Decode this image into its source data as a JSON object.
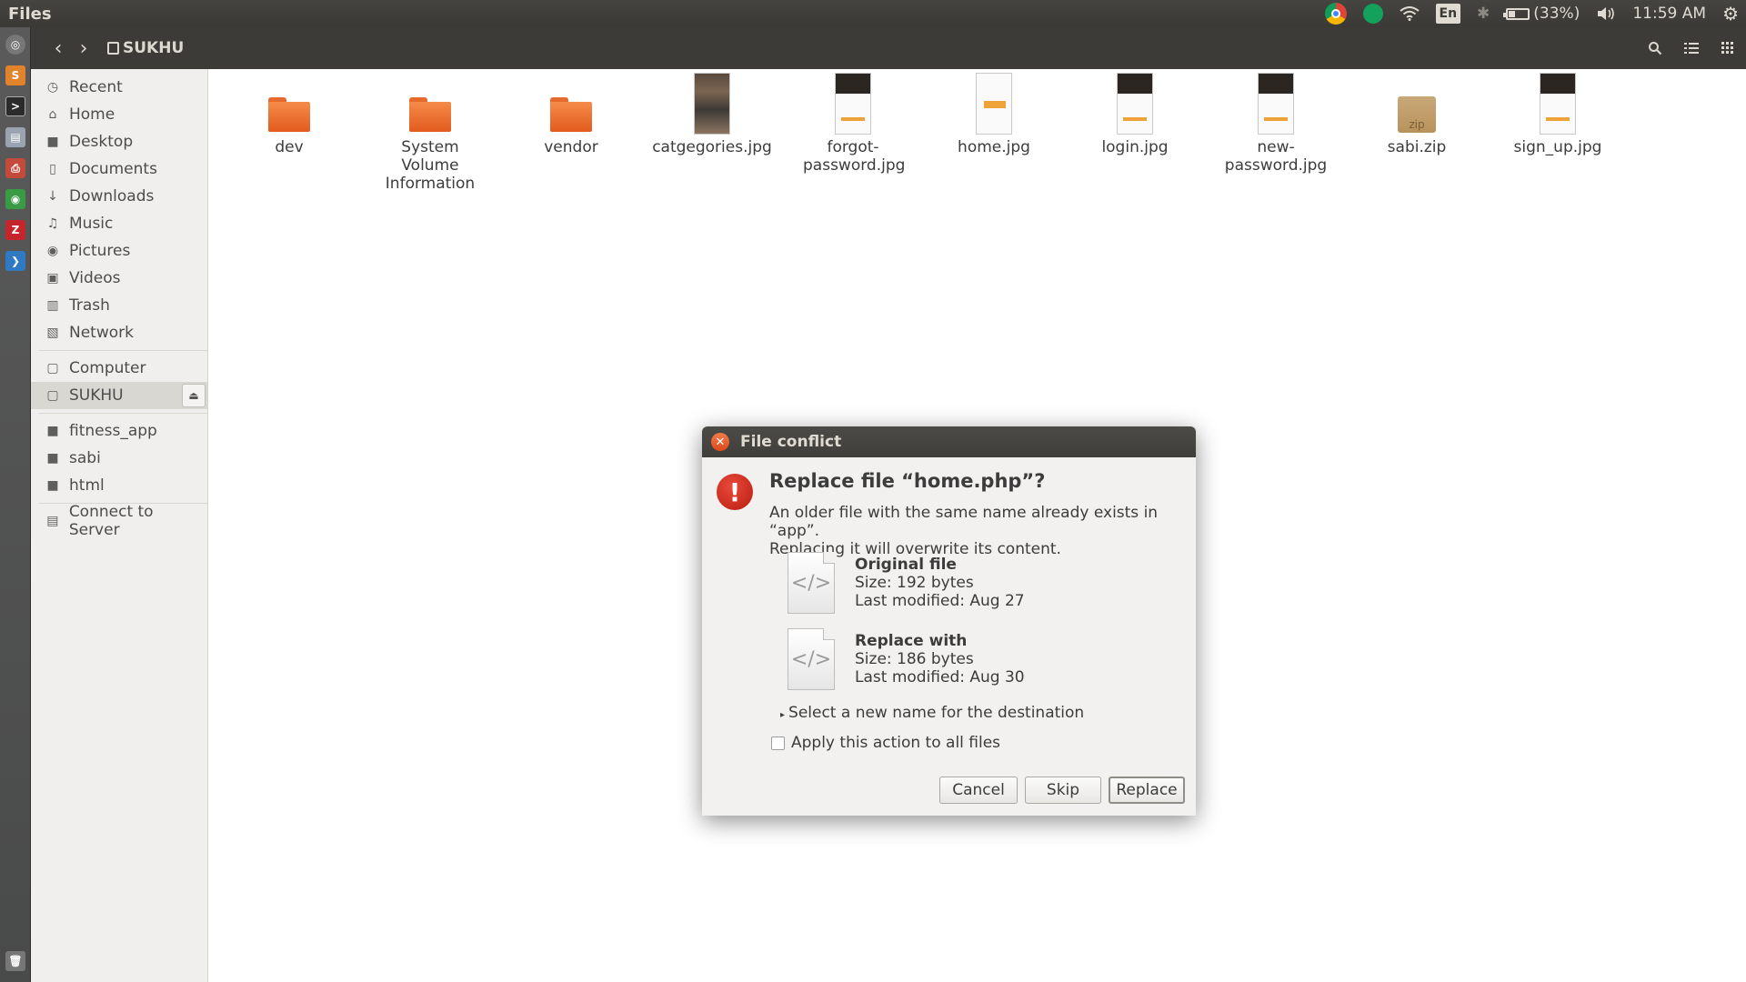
{
  "topbar": {
    "app_title": "Files",
    "indicators": {
      "chrome": "chrome-icon",
      "green": "green-app-icon",
      "wifi": "wifi-icon",
      "language": "En",
      "bluetooth": "bluetooth-icon",
      "battery_text": "(33%)",
      "volume": "volume-icon",
      "clock": "11:59 AM",
      "settings": "gear-icon"
    }
  },
  "headerbar": {
    "path_label": "SUKHU"
  },
  "sidebar": {
    "places": [
      {
        "label": "Recent",
        "icon": "clock-icon"
      },
      {
        "label": "Home",
        "icon": "home-icon"
      },
      {
        "label": "Desktop",
        "icon": "folder-icon"
      },
      {
        "label": "Documents",
        "icon": "document-icon"
      },
      {
        "label": "Downloads",
        "icon": "download-icon"
      },
      {
        "label": "Music",
        "icon": "music-icon"
      },
      {
        "label": "Pictures",
        "icon": "camera-icon"
      },
      {
        "label": "Videos",
        "icon": "video-icon"
      },
      {
        "label": "Trash",
        "icon": "trash-icon"
      },
      {
        "label": "Network",
        "icon": "network-icon"
      }
    ],
    "devices": [
      {
        "label": "Computer",
        "icon": "drive-icon"
      },
      {
        "label": "SUKHU",
        "icon": "drive-icon"
      }
    ],
    "bookmarks": [
      {
        "label": "fitness_app",
        "icon": "folder-icon"
      },
      {
        "label": "sabi",
        "icon": "folder-icon"
      },
      {
        "label": "html",
        "icon": "folder-icon"
      }
    ],
    "connect": {
      "label": "Connect to Server",
      "icon": "server-icon"
    }
  },
  "files": [
    {
      "name": "dev",
      "type": "folder"
    },
    {
      "name": "System Volume Information",
      "type": "folder"
    },
    {
      "name": "vendor",
      "type": "folder"
    },
    {
      "name": "catgegories.jpg",
      "type": "image-photo"
    },
    {
      "name": "forgot-password.jpg",
      "type": "image-dark"
    },
    {
      "name": "home.jpg",
      "type": "image-home"
    },
    {
      "name": "login.jpg",
      "type": "image-dark"
    },
    {
      "name": "new-password.jpg",
      "type": "image-dark"
    },
    {
      "name": "sabi.zip",
      "type": "zip"
    },
    {
      "name": "sign_up.jpg",
      "type": "image-dark"
    }
  ],
  "dialog": {
    "title": "File conflict",
    "heading": "Replace file “home.php”?",
    "message_line1": "An older file with the same name already exists in “app”.",
    "message_line2": "Replacing it will overwrite its content.",
    "original": {
      "title": "Original file",
      "size": "Size: 192 bytes",
      "modified": "Last modified: Aug 27"
    },
    "replacement": {
      "title": "Replace with",
      "size": "Size: 186 bytes",
      "modified": "Last modified: Aug 30"
    },
    "rename_expander": "Select a new name for the destination",
    "apply_all_label": "Apply this action to all files",
    "buttons": {
      "cancel": "Cancel",
      "skip": "Skip",
      "replace": "Replace"
    }
  }
}
